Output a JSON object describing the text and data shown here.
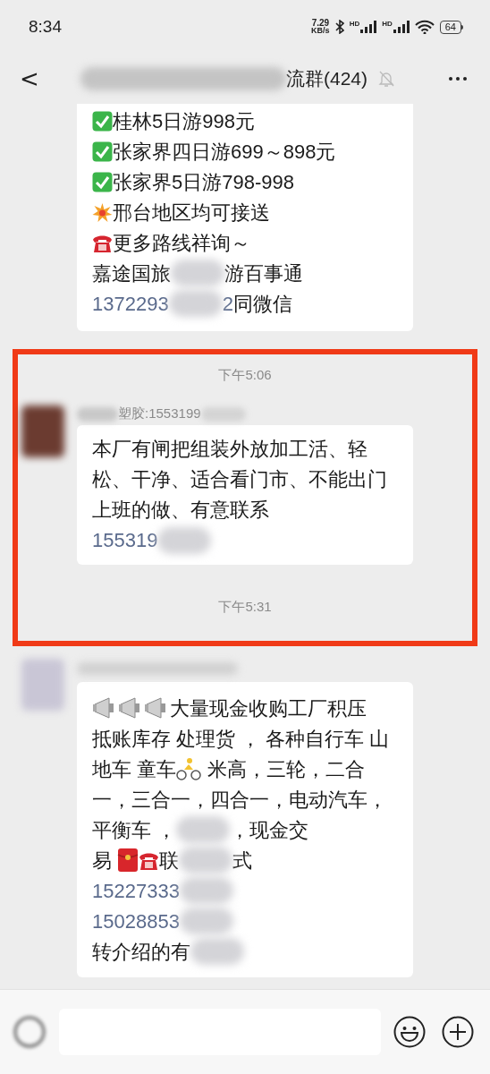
{
  "status_bar": {
    "time": "8:34",
    "speed_value": "7.29",
    "speed_unit": "KB/s",
    "sim_1": "HD",
    "sim_2": "HD",
    "battery": "64"
  },
  "header": {
    "back": "<",
    "title_visible": "流群(424)",
    "muted": true
  },
  "messages": [
    {
      "kind": "continued",
      "lines": [
        [
          {
            "kind": "check"
          },
          {
            "kind": "text",
            "text": "桂林5日游998元"
          }
        ],
        [
          {
            "kind": "check"
          },
          {
            "kind": "text",
            "text": "张家界四日游699～898元"
          }
        ],
        [
          {
            "kind": "check"
          },
          {
            "kind": "text",
            "text": "张家界5日游798-998"
          }
        ],
        [
          {
            "kind": "burst"
          },
          {
            "kind": "text",
            "text": "邢台地区均可接送"
          }
        ],
        [
          {
            "kind": "telephone"
          },
          {
            "kind": "text",
            "text": "更多路线祥询～"
          }
        ],
        [
          {
            "kind": "text",
            "text": "嘉途国旅"
          },
          {
            "kind": "blur"
          },
          {
            "kind": "text",
            "text": "游百事通"
          }
        ],
        [
          {
            "kind": "link",
            "text": "1372293"
          },
          {
            "kind": "blur"
          },
          {
            "kind": "link",
            "text": "2"
          },
          {
            "kind": "text",
            "text": "同微信"
          }
        ]
      ]
    },
    {
      "kind": "highlighted",
      "time_before": "下午5:06",
      "time_after": "下午5:31",
      "sender": "塑胶:1553199",
      "lines": [
        [
          {
            "kind": "text",
            "text": "本厂有闸把组装外放加工活、轻"
          }
        ],
        [
          {
            "kind": "text",
            "text": "松、干净、适合看门市、不能出门"
          }
        ],
        [
          {
            "kind": "text",
            "text": "上班的做、有意联系"
          }
        ],
        [
          {
            "kind": "link",
            "text": "155319"
          },
          {
            "kind": "blur"
          }
        ]
      ]
    },
    {
      "kind": "normal",
      "lines": [
        [
          {
            "kind": "megaphone"
          },
          {
            "kind": "megaphone"
          },
          {
            "kind": "megaphone"
          },
          {
            "kind": "text",
            "text": "大量现金收购工厂积压"
          }
        ],
        [
          {
            "kind": "text",
            "text": "抵账库存 处理货 ， 各种自行车 山"
          }
        ],
        [
          {
            "kind": "text",
            "text": "地车 童车"
          },
          {
            "kind": "cyclist"
          },
          {
            "kind": "text",
            "text": " 米高，三轮，二合"
          }
        ],
        [
          {
            "kind": "text",
            "text": "一，三合一，四合一，电动汽车，"
          }
        ],
        [
          {
            "kind": "text",
            "text": "平衡车 ，"
          },
          {
            "kind": "blur"
          },
          {
            "kind": "text",
            "text": "，现金交"
          }
        ],
        [
          {
            "kind": "text",
            "text": "易 "
          },
          {
            "kind": "red-packet"
          },
          {
            "kind": "telephone"
          },
          {
            "kind": "text",
            "text": "联"
          },
          {
            "kind": "blur"
          },
          {
            "kind": "text",
            "text": "式"
          }
        ],
        [
          {
            "kind": "link",
            "text": "15227333"
          },
          {
            "kind": "blur"
          }
        ],
        [
          {
            "kind": "link",
            "text": "15028853"
          },
          {
            "kind": "blur"
          }
        ],
        [
          {
            "kind": "text",
            "text": "转介绍的有"
          },
          {
            "kind": "blur"
          }
        ]
      ]
    }
  ]
}
